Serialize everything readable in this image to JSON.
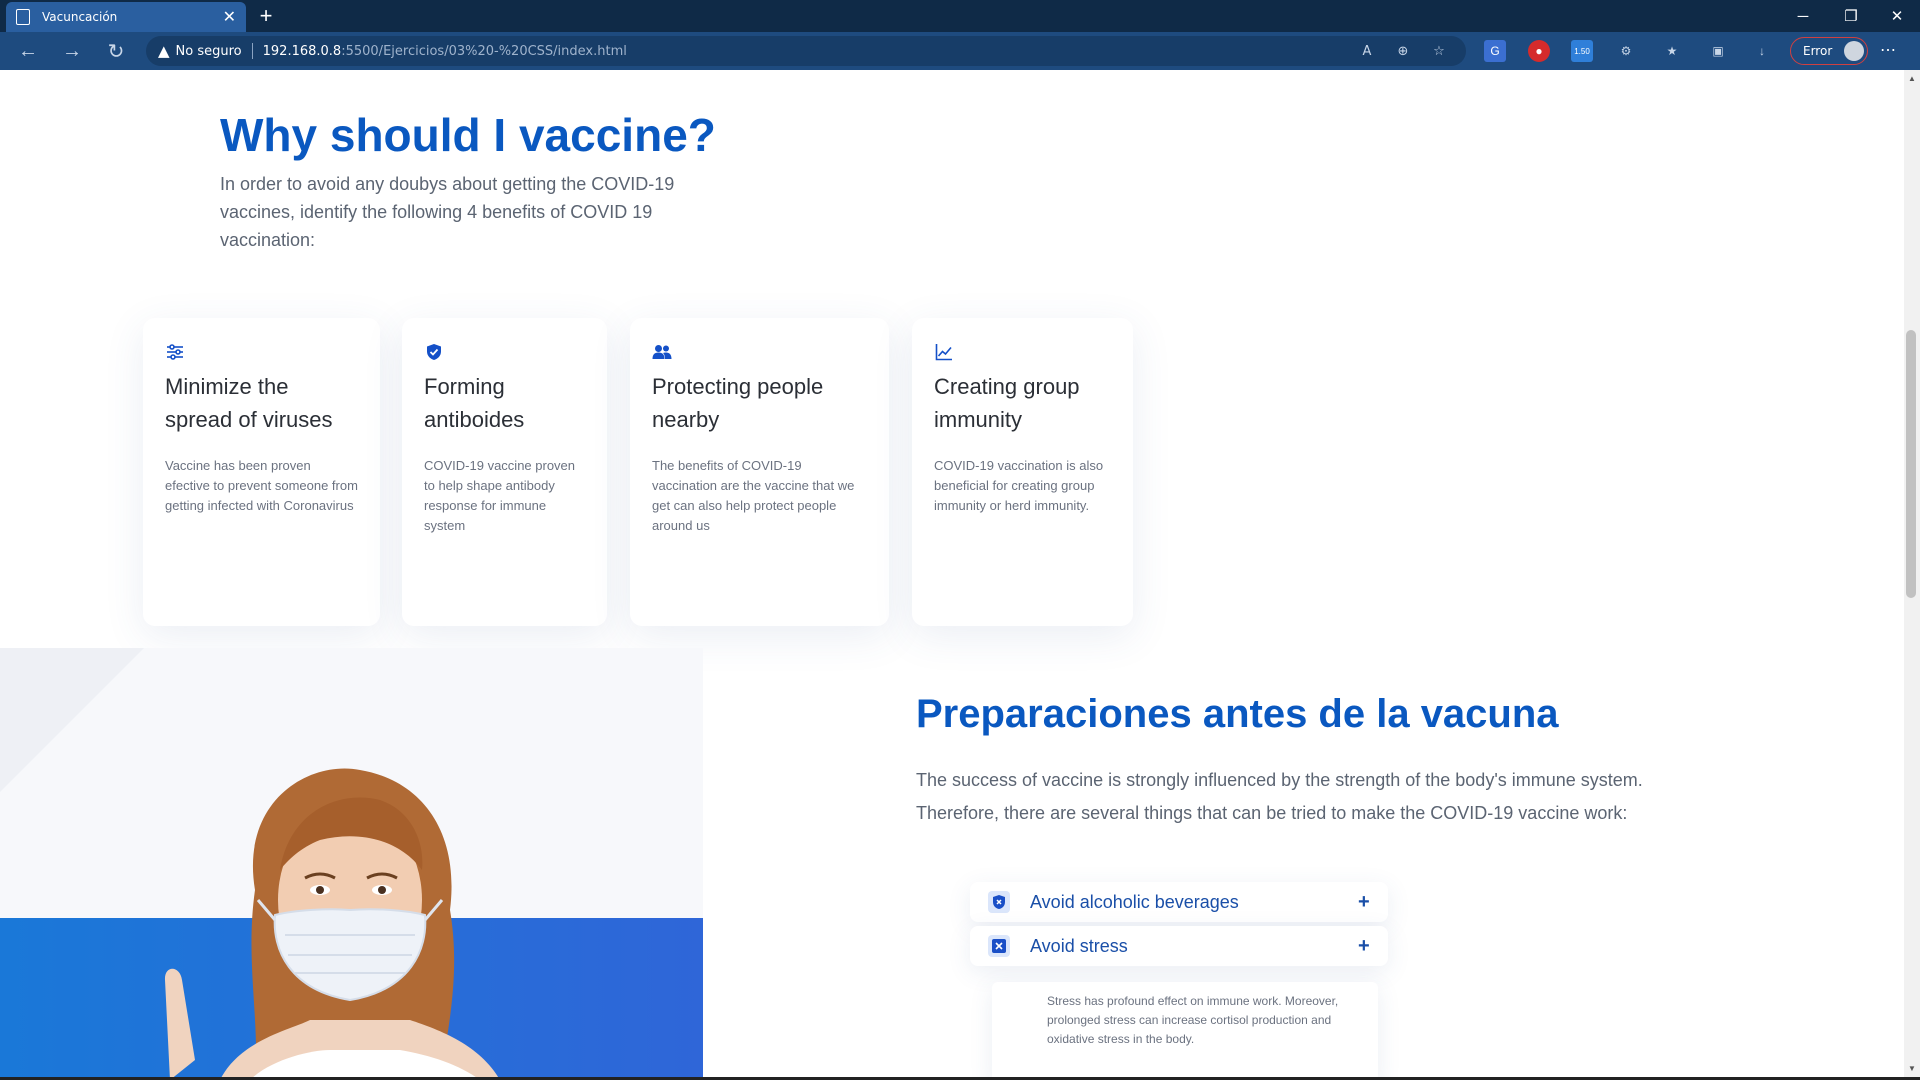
{
  "browser": {
    "tab_title": "Vacuncación",
    "tab_close": "✕",
    "new_tab": "+",
    "security_label": "No seguro",
    "url_host": "192.168.0.8",
    "url_path": ":5500/Ejercicios/03%20-%20CSS/index.html",
    "profile_status": "Error",
    "extension_badge": "1.50"
  },
  "why": {
    "title": "Why should I vaccine?",
    "description": "In order to avoid any doubys about getting the COVID-19 vaccines, identify the following 4 benefits of COVID 19 vaccination:"
  },
  "benefits": [
    {
      "icon": "sliders-icon",
      "title": "Minimize the spread of viruses",
      "text": "Vaccine has been proven efective to prevent someone from getting infected with Coronavirus"
    },
    {
      "icon": "shield-check-icon",
      "title": "Forming antiboides",
      "text": "COVID-19 vaccine proven to help shape antibody response for immune system"
    },
    {
      "icon": "people-icon",
      "title": "Protecting people nearby",
      "text": "The benefits of COVID-19 vaccination are the vaccine that we get can also help protect people around us"
    },
    {
      "icon": "chart-line-icon",
      "title": "Creating group immunity",
      "text": "COVID-19 vaccination is also beneficial for creating group immunity or herd immunity."
    }
  ],
  "prep": {
    "title": "Preparaciones antes de la vacuna",
    "description": "The success of vaccine is strongly influenced by the strength of the body's immune system. Therefore, there are several things that can be tried to make the COVID-19 vaccine work:",
    "items": [
      {
        "label": "Avoid alcoholic beverages",
        "toggle": "+"
      },
      {
        "label": "Avoid stress",
        "toggle": "+"
      }
    ],
    "expanded_text": "Stress has profound effect on immune work. Moreover, prolonged stress can increase cortisol production and oxidative stress in the body."
  },
  "colors": {
    "accent": "#0a58c0",
    "chrome": "#1e4b7f",
    "tab": "#2a5fa0"
  }
}
